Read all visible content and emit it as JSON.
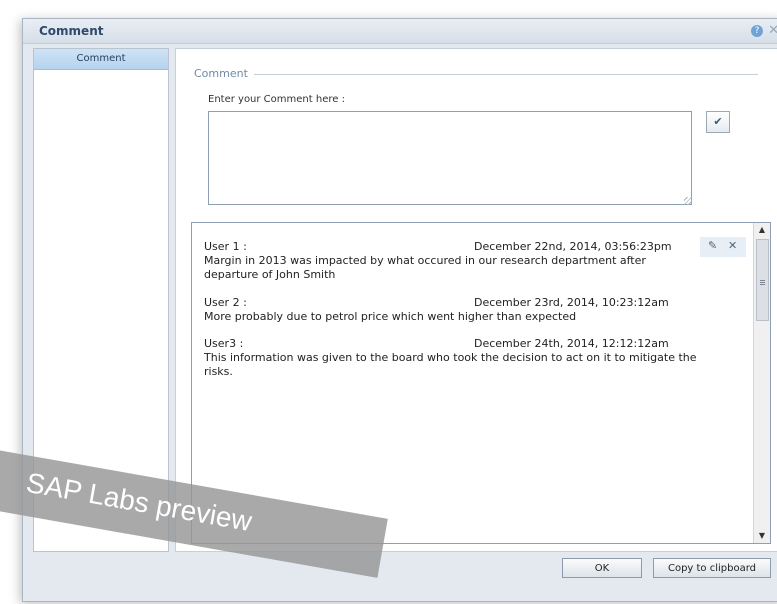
{
  "window": {
    "title": "Comment"
  },
  "sidebar": {
    "tab_label": "Comment"
  },
  "form": {
    "section_title": "Comment",
    "input_label": "Enter your Comment here :",
    "input_value": ""
  },
  "comments": [
    {
      "user": "User 1 :",
      "date": "December 22nd, 2014, 03:56:23pm",
      "text": "Margin in 2013 was impacted by what occured in our research department after departure of John Smith"
    },
    {
      "user": "User 2 :",
      "date": "December 23rd, 2014, 10:23:12am",
      "text": "More probably due to petrol price which went higher than expected"
    },
    {
      "user": "User3 :",
      "date": "December 24th, 2014, 12:12:12am",
      "text": "This information was given to the board who took the decision to act on it to mitigate the risks."
    }
  ],
  "buttons": {
    "ok": "OK",
    "copy": "Copy to clipboard"
  },
  "watermark": "SAP Labs preview",
  "icons": {
    "submit": "checkmark-icon",
    "edit": "edit-icon",
    "delete": "close-icon",
    "help": "help-icon"
  }
}
